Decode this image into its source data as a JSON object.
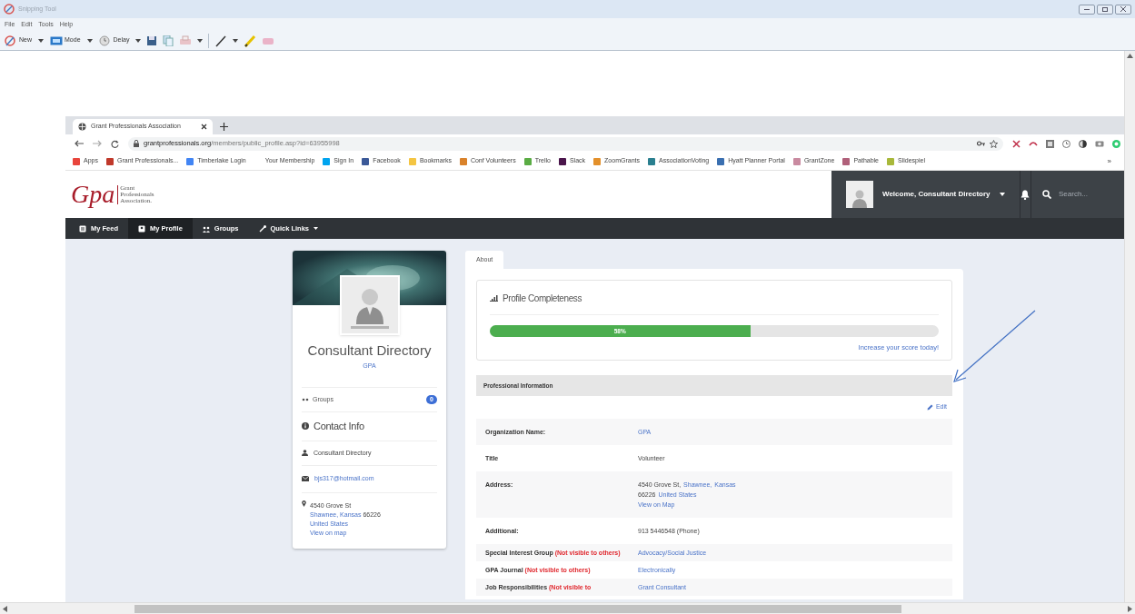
{
  "window": {
    "title": "Snipping Tool"
  },
  "menu": [
    "File",
    "Edit",
    "Tools",
    "Help"
  ],
  "toolbar": [
    {
      "kind": "new",
      "label": "New"
    },
    {
      "kind": "mode",
      "label": "Mode"
    },
    {
      "kind": "delay",
      "label": "Delay"
    }
  ],
  "browser": {
    "tab_title": "Grant Professionals Association",
    "url_domain": "grantprofessionals.org",
    "url_path": "/members/public_profile.asp?id=63955998",
    "bookmarks": [
      {
        "label": "Apps",
        "color": "#e8453c"
      },
      {
        "label": "Grant Professionals...",
        "color": "#c0392b"
      },
      {
        "label": "Timberlake Login",
        "color": "#4285f4"
      },
      {
        "label": "Your Membership"
      },
      {
        "label": "Sign In",
        "color": "#00a4ef"
      },
      {
        "label": "Facebook",
        "color": "#3b5998"
      },
      {
        "label": "Bookmarks",
        "color": "#f4c542"
      },
      {
        "label": "Conf Volunteers",
        "color": "#d9822b"
      },
      {
        "label": "Trello",
        "color": "#5aac44"
      },
      {
        "label": "Slack",
        "color": "#4a154b"
      },
      {
        "label": "ZoomGrants",
        "color": "#e3902b"
      },
      {
        "label": "AssociationVoting",
        "color": "#2a7f8f"
      },
      {
        "label": "Hyatt Planner Portal",
        "color": "#3a6fb0"
      },
      {
        "label": "GrantZone",
        "color": "#c98aa0"
      },
      {
        "label": "Pathable",
        "color": "#b0607a"
      },
      {
        "label": "Slidespiel",
        "color": "#a8b83a"
      }
    ],
    "more": "»"
  },
  "site": {
    "logo_mark": "Gpa",
    "logo_lines": [
      "Grant",
      "Professionals",
      "Association."
    ],
    "welcome": "Welcome, Consultant Directory",
    "search_placeholder": "Search...",
    "nav": [
      {
        "kind": "feed",
        "label": "My Feed",
        "selected": false
      },
      {
        "kind": "profile",
        "label": "My Profile",
        "selected": true
      },
      {
        "kind": "groups",
        "label": "Groups",
        "selected": false
      },
      {
        "kind": "links",
        "label": "Quick Links",
        "selected": false
      }
    ]
  },
  "profile_card": {
    "name": "Consultant Directory",
    "organization": "GPA",
    "groups_label": "Groups",
    "groups_count": "0",
    "contact_heading": "Contact Info",
    "contact_name": "Consultant Directory",
    "email": "bjs317@hotmail.com",
    "address_street": "4540 Grove St",
    "address_city": "Shawnee, Kansas",
    "address_zip": " 66226",
    "address_country": "United States",
    "map_link": "View on map"
  },
  "tabs": [
    {
      "label": "About",
      "selected": true
    }
  ],
  "completeness": {
    "title": "Profile Completeness",
    "level": 0.58,
    "reading": "58%",
    "link": "Increase your score today!"
  },
  "section": {
    "title": "Professional Information",
    "edit": "Edit",
    "rows": [
      {
        "label": "Organization Name:",
        "lines": [
          [
            {
              "text": "GPA",
              "link": true
            }
          ]
        ]
      },
      {
        "label": "Title",
        "lines": [
          [
            {
              "text": "Volunteer",
              "link": false
            }
          ]
        ]
      },
      {
        "label": "Address:",
        "lines": [
          [
            {
              "text": "4540 Grove St,",
              "link": false
            },
            {
              "text": "Shawnee,",
              "link": true
            },
            {
              "text": "Kansas",
              "link": true
            }
          ],
          [
            {
              "text": "66226",
              "link": false
            },
            {
              "text": "United States",
              "link": true
            }
          ],
          [
            {
              "text": "View on Map",
              "link": true
            }
          ]
        ]
      },
      {
        "label": "Additional:",
        "lines": [
          [
            {
              "text": "913 5446548 (Phone)",
              "link": false
            }
          ]
        ]
      },
      {
        "label": "Special Interest Group",
        "note": "(Not visible to others)",
        "lines": [
          [
            {
              "text": "Advocacy/Social Justice",
              "link": true
            }
          ]
        ]
      },
      {
        "label": "GPA Journal",
        "note": "(Not visible to others)",
        "lines": [
          [
            {
              "text": "Electronically",
              "link": true
            }
          ]
        ]
      },
      {
        "label": "Job Responsibilities",
        "note": "(Not visible to",
        "lines": [
          [
            {
              "text": "Grant Consultant",
              "link": true
            }
          ]
        ]
      }
    ]
  }
}
